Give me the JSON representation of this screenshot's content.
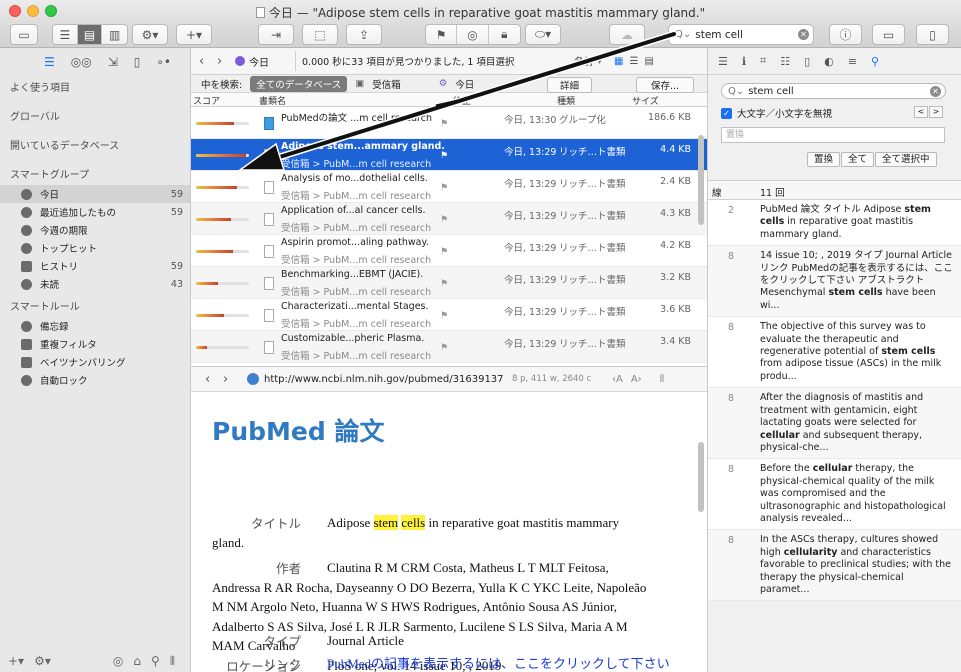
{
  "window": {
    "title": "今日 — \"Adipose stem cells in reparative goat mastitis mammary gland.\""
  },
  "toolbar": {
    "search_value": "stem cell"
  },
  "sidebar": {
    "sections": [
      {
        "heading": "よく使う項目"
      },
      {
        "heading": "グローバル"
      },
      {
        "heading": "開いているデータベース"
      },
      {
        "heading": "スマートグループ",
        "items": [
          {
            "label": "今日",
            "count": "59",
            "icon": "clock-icon",
            "selected": true
          },
          {
            "label": "最近追加したもの",
            "count": "59",
            "icon": "clock-icon"
          },
          {
            "label": "今週の期限",
            "count": "",
            "icon": "clock-icon"
          },
          {
            "label": "トップヒット",
            "count": "",
            "icon": "clock-icon"
          },
          {
            "label": "ヒストリ",
            "count": "59",
            "icon": "gear-icon"
          },
          {
            "label": "未読",
            "count": "43",
            "icon": "circle-icon"
          }
        ]
      },
      {
        "heading": "スマートルール",
        "items": [
          {
            "label": "備忘録",
            "icon": "clock-icon"
          },
          {
            "label": "重複フィルタ",
            "icon": "gear-icon"
          },
          {
            "label": "ベイツナンバリング",
            "icon": "gear-icon"
          },
          {
            "label": "自動ロック",
            "icon": "clock-icon"
          }
        ]
      }
    ]
  },
  "list": {
    "location": "今日",
    "status": "0.000 秒に33 項目が見つかりました, 1 項目選択",
    "sort_label": "名前",
    "scope_label": "中を検索:",
    "scope_all": "全てのデータベース",
    "scope_inbox": "受信箱",
    "scope_today": "今日",
    "details_button": "詳細",
    "save_button": "保存...",
    "columns": {
      "score": "スコア",
      "name": "書類名",
      "modified": "修正",
      "kind": "種類",
      "size": "サイズ"
    },
    "rows": [
      {
        "title": "PubMedの論文 ...m cell research",
        "path": "",
        "date": "今日, 13:30",
        "kind": "グループ化",
        "size": "186.6 KB",
        "score": 0.72,
        "group": true
      },
      {
        "title": "Adipose stem...ammary gland.",
        "path": "受信箱 > PubM...m cell research",
        "date": "今日, 13:29",
        "kind": "リッチ…ト書類",
        "size": "4.4 KB",
        "score": 0.95,
        "selected": true
      },
      {
        "title": "Analysis of mo...dothelial cells.",
        "path": "受信箱 > PubM...m cell research",
        "date": "今日, 13:29",
        "kind": "リッチ…ト書類",
        "size": "2.4 KB",
        "score": 0.78
      },
      {
        "title": "Application of...al cancer cells.",
        "path": "受信箱 > PubM...m cell research",
        "date": "今日, 13:29",
        "kind": "リッチ…ト書類",
        "size": "4.3 KB",
        "score": 0.66
      },
      {
        "title": "Aspirin promot...aling pathway.",
        "path": "受信箱 > PubM...m cell research",
        "date": "今日, 13:29",
        "kind": "リッチ…ト書類",
        "size": "4.2 KB",
        "score": 0.7
      },
      {
        "title": "Benchmarking...EBMT (JACIE).",
        "path": "受信箱 > PubM...m cell research",
        "date": "今日, 13:29",
        "kind": "リッチ…ト書類",
        "size": "3.2 KB",
        "score": 0.42
      },
      {
        "title": "Characterizati...mental Stages.",
        "path": "受信箱 > PubM...m cell research",
        "date": "今日, 13:29",
        "kind": "リッチ…ト書類",
        "size": "3.6 KB",
        "score": 0.52
      },
      {
        "title": "Customizable...pheric Plasma.",
        "path": "受信箱 > PubM...m cell research",
        "date": "今日, 13:29",
        "kind": "リッチ…ト書類",
        "size": "3.4 KB",
        "score": 0.2
      }
    ]
  },
  "viewer": {
    "url": "http://www.ncbi.nlm.nih.gov/pubmed/31639137",
    "meta": "8 p, 411 w, 2640 c",
    "heading": "PubMed 論文",
    "labels": {
      "title": "タイトル",
      "author": "作者",
      "location": "ロケーション",
      "type": "タイプ",
      "link": "リンク"
    },
    "title_pre": "Adipose ",
    "title_hl1": "stem",
    "title_hl2": "cells",
    "title_post": " in reparative goat mastitis mammary",
    "title_cont": "gland.",
    "author_line1": "Clautina R M CRM Costa, Matheus L T MLT Feitosa,",
    "author_line2": "Andressa R AR Rocha, Dayseanny O DO Bezerra, Yulla K C YKC Leite, Napoleão",
    "author_line3": "M NM Argolo Neto, Huanna W S HWS Rodrigues, Antônio Sousa AS Júnior,",
    "author_line4": "Adalberto S AS Silva, José L R JLR Sarmento, Lucilene S LS Silva, Maria A M",
    "author_line5": "MAM Carvalho",
    "location": "PloS one; vol. 14 issue 10; , 2019",
    "type": "Journal Article",
    "link": "PubMedの記事を表示するには、ここをクリックして下さい"
  },
  "inspector": {
    "search_value": "stem cell",
    "ignore_case": "大文字／小文字を無視",
    "replace_placeholder": "置換",
    "buttons": [
      "置換",
      "全て",
      "全て選択中"
    ],
    "col_line": "線",
    "col_count": "11 回",
    "results": [
      {
        "line": "2",
        "pre": "PubMed 論文 タイトル Adipose ",
        "bold": "stem cells",
        "post": " in reparative goat mastitis mammary gland."
      },
      {
        "line": "8",
        "pre": "14 issue 10; , 2019 タイプ Journal Article リンク PubMedの記事を表示するには、ここをクリックして下さい アブストラクト Mesenchymal ",
        "bold": "stem cells",
        "post": " have been wi..."
      },
      {
        "line": "8",
        "pre": "The objective of this survey was to evaluate the therapeutic and regenerative potential of ",
        "bold": "stem cells",
        "post": " from adipose tissue (ASCs) in the milk produ..."
      },
      {
        "line": "8",
        "pre": "After the diagnosis of mastitis and treatment with gentamicin, eight lactating goats were selected for ",
        "bold": "cellular",
        "post": " and subsequent therapy, physical-che..."
      },
      {
        "line": "8",
        "pre": "Before the ",
        "bold": "cellular",
        "post": " therapy, the physical-chemical quality of the milk was compromised and the ultrasonographic and histopathological analysis revealed..."
      },
      {
        "line": "8",
        "pre": "In the ASCs therapy, cultures showed high ",
        "bold": "cellularity",
        "post": " and characteristics favorable to preclinical studies; with the therapy the physical-chemical paramet..."
      }
    ]
  }
}
